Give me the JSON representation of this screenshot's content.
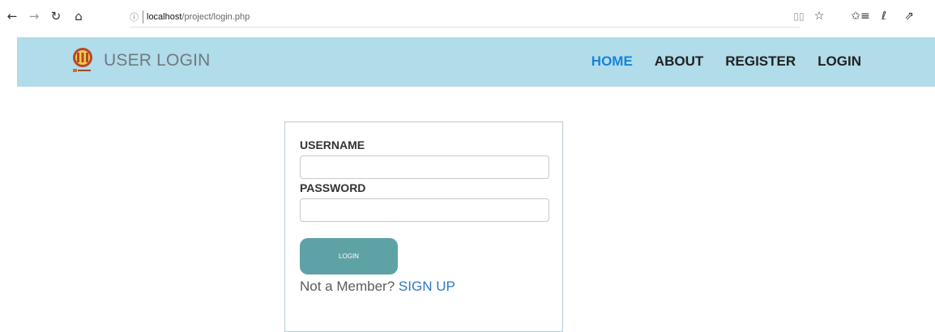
{
  "browser": {
    "info_icon": "ⓘ",
    "url_host": "localhost",
    "url_path": "/project/login.php",
    "icons": [
      "back-arrow-icon",
      "forward-arrow-icon",
      "refresh-icon",
      "home-icon",
      "reading-view-icon",
      "favorite-star-icon",
      "favorites-list-icon",
      "pen-icon",
      "share-icon"
    ]
  },
  "navbar": {
    "brand_title": "USER LOGIN",
    "links": [
      {
        "label": "HOME",
        "active": true
      },
      {
        "label": "ABOUT",
        "active": false
      },
      {
        "label": "REGISTER",
        "active": false
      },
      {
        "label": "LOGIN",
        "active": false
      }
    ],
    "active_color": "#1685d6",
    "background": "#b1dcea"
  },
  "form": {
    "username_label": "USERNAME",
    "username_value": "",
    "password_label": "PASSWORD",
    "password_value": "",
    "login_button": "LOGIN",
    "signup_prompt": "Not a Member?",
    "signup_link": "SIGN UP"
  }
}
